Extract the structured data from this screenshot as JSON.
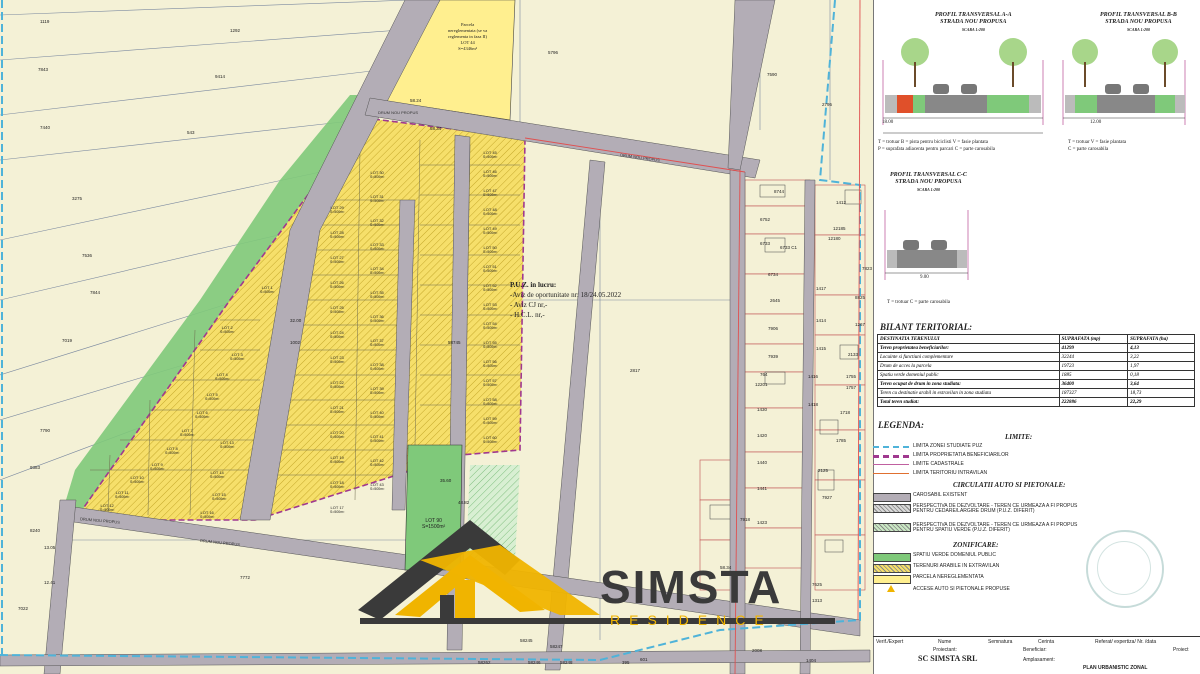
{
  "brand": {
    "name": "SIMSTA",
    "subtitle": "RESIDENCE"
  },
  "colors": {
    "agricultural": "#f4f1d6",
    "parcel_yellow": "#ffef8f",
    "lots_yellow": "#f6df6a",
    "roads_gray": "#b3adb6",
    "green_public": "#7fc97a",
    "purple_limit": "#a0388f",
    "blue_limit": "#4fb3d9",
    "cadastral_red": "#e05050",
    "brand_gray": "#3a3a3a",
    "brand_yellow": "#f0b400"
  },
  "puz_note": {
    "title": "P.U.Z. in lucru:",
    "lines": [
      "-Aviz de oportunitate nr: 18/24.05.2022",
      "- Aviz CJ nr,-",
      "- H.C.L. nr,-"
    ]
  },
  "parcela_note": [
    "Parcela",
    "nereglementata (se va",
    "reglementa in faza II)",
    "LOT 44",
    "S=4346m²"
  ],
  "map_labels": {
    "parcels": [
      "1119",
      "1292",
      "7843",
      "9414",
      "7440",
      "543",
      "3275",
      "7536",
      "7844",
      "7019",
      "7790",
      "9383",
      "8240",
      "7022",
      "7772",
      "5796",
      "7590",
      "2795",
      "2817",
      "8744",
      "6752",
      "6733",
      "6733 C1",
      "6734",
      "2645",
      "7906",
      "7939",
      "764",
      "12201",
      "1430",
      "1420",
      "1440",
      "1441",
      "7918",
      "2125",
      "7927",
      "1423",
      "1416",
      "1418",
      "1414",
      "1415",
      "1417",
      "1755",
      "1757",
      "1718",
      "1785",
      "2133",
      "7625",
      "1313",
      "601",
      "58247",
      "58246",
      "58248",
      "58262",
      "58245",
      "395",
      "2008",
      "1404",
      "1412",
      "12185",
      "12180",
      "8825",
      "1267",
      "7823"
    ],
    "lots": [
      "LOT 1",
      "LOT 2",
      "LOT 3",
      "LOT 4",
      "LOT 5",
      "LOT 6",
      "LOT 7",
      "LOT 8",
      "LOT 9",
      "LOT 10",
      "LOT 11",
      "LOT 12",
      "LOT 13",
      "LOT 14",
      "LOT 15",
      "LOT 16",
      "LOT 17",
      "LOT 18",
      "LOT 19",
      "LOT 20",
      "LOT 21",
      "LOT 22",
      "LOT 23",
      "LOT 24",
      "LOT 25",
      "LOT 26",
      "LOT 27",
      "LOT 28",
      "LOT 29",
      "LOT 30",
      "LOT 31",
      "LOT 32",
      "LOT 33",
      "LOT 34",
      "LOT 35",
      "LOT 36",
      "LOT 37",
      "LOT 38",
      "LOT 39",
      "LOT 40",
      "LOT 41",
      "LOT 42",
      "LOT 43",
      "LOT 45",
      "LOT 46",
      "LOT 47",
      "LOT 48",
      "LOT 49",
      "LOT 50",
      "LOT 51",
      "LOT 52",
      "LOT 53",
      "LOT 54",
      "LOT 55",
      "LOT 56",
      "LOT 57",
      "LOT 58",
      "LOT 59",
      "LOT 60"
    ],
    "lot_area": "S=500m²",
    "lot_big": "LOT 90",
    "lot_big_area": "S=1500m²",
    "roads": [
      "DRUM NOU PROPUS",
      "DRUM NOU PROPUS",
      "DRUM NOU PROPUS",
      "DRUM NOU PROPUS"
    ],
    "dims": [
      "58.24",
      "32.00",
      "1002",
      "58745",
      "35.60",
      "48.82",
      "12.41",
      "13.05",
      "58.34",
      "58.34"
    ]
  },
  "profiles": [
    {
      "title": "PROFIL TRANSVERSAL A-A",
      "subtitle": "STRADA NOU PROPUSA",
      "scale": "SCARA 1:200",
      "dims": [
        "1.50",
        "3.00",
        "2.00",
        "3.50",
        "3.50",
        "2.00",
        "3.00",
        "1.50"
      ],
      "total": "18.00",
      "legend": [
        "T = trotuar   B = pista pentru biciclisti  V = fasie plantata",
        "P = suprafata adiacenta pentru parcari   C = parte carosabila"
      ]
    },
    {
      "title": "PROFIL TRANSVERSAL B-B",
      "subtitle": "STRADA NOU PROPUSA",
      "scale": "SCARA 1:200",
      "dims": [
        "1.50",
        "3.00",
        "2.50",
        "3.50",
        "3.00",
        "1.50"
      ],
      "total": "12.00",
      "legend": [
        "T = trotuar   V = fasie plantata",
        "C = parte carosabila"
      ]
    },
    {
      "title": "PROFIL TRANSVERSAL C-C",
      "subtitle": "STRADA NOU PROPUSA",
      "scale": "SCARA 1:200",
      "dims": [
        "1.50",
        "3.00",
        "3.00",
        "1.50"
      ],
      "total": "9.00",
      "legend": [
        "T = trotuar   C = parte carosabila"
      ]
    }
  ],
  "profile_side_label": "limita cadastrala",
  "bilant": {
    "title": "BILANT TERITORIAL:",
    "headers": [
      "DESTINATIA TERENULUI",
      "SUPRAFATA (mp)",
      "SUPRAFATA (ha)"
    ],
    "rows": [
      [
        "Teren proprietatea beneficiarilor:",
        "41299",
        "4,13"
      ],
      [
        "Locuinte si functiuni complementare",
        "32244",
        "3,22"
      ],
      [
        "Drum de acces la parcela",
        "19723",
        "1,97"
      ],
      [
        "Spatiu verde domeniul public",
        "1885",
        "0,18"
      ],
      [
        "Teren ocupat de drum in zona studiata:",
        "36400",
        "3,64"
      ],
      [
        "Teren cu destinatie arabil in extravilan in zona studiata",
        "187327",
        "18,73"
      ],
      [
        "Total teren studiat:",
        "222886",
        "22,29"
      ]
    ]
  },
  "legend": {
    "title": "LEGENDA:",
    "limite_title": "LIMITE:",
    "limite": [
      {
        "label": "LIMITA ZONEI STUDIATE PUZ",
        "color": "#4fb3d9",
        "style": "dashed"
      },
      {
        "label": "LIMITA PROPRIETATIA BENEFICIARILOR",
        "color": "#a0388f",
        "style": "dashed-thick"
      },
      {
        "label": "LIMITE CADASTRALE",
        "color": "#c060a0",
        "style": "solid"
      },
      {
        "label": "LIMITA TERITORIU INTRAVILAN",
        "color": "#e07030",
        "style": "solid"
      }
    ],
    "circ_title": "CIRCULATII AUTO SI PIETONALE:",
    "circ": [
      {
        "label": "CAROSABIL EXISTENT",
        "fill": "#b3adb6",
        "pattern": "solid"
      },
      {
        "label": "PERSPECTIVA DE DEZVOLTARE - TEREN CE URMEAZA A FI PROPUS PENTRU CEDARE/LARGIRE DRUM (P.U.Z. DIFERIT)",
        "fill": "#d8d8d8",
        "pattern": "hatch"
      },
      {
        "label": "PERSPECTIVA DE DEZVOLTARE - TEREN CE URMEAZA A FI PROPUS PENTRU SPATIU VERDE (P.U.Z. DIFERIT)",
        "fill": "#c9e8c3",
        "pattern": "hatch"
      }
    ],
    "zon_title": "ZONIFICARE:",
    "zon": [
      {
        "label": "SPATIU VERDE DOMENIUL PUBLIC",
        "fill": "#7fc97a",
        "pattern": "solid"
      },
      {
        "label": "TERENURI ARABILE IN EXTRAVILAN",
        "fill": "#f6df6a",
        "pattern": "hatch"
      },
      {
        "label": "PARCELA NEREGLEMENTATA",
        "fill": "#ffef8f",
        "pattern": "solid"
      }
    ],
    "access": "ACCESE AUTO SI PIETONALE PROPUSE"
  },
  "titleblock": {
    "cols": [
      "Verif./Expert",
      "Nume",
      "Semnatura",
      "Cerinta",
      "Referat/ expertiza/ Nr. /data"
    ],
    "designer_label": "Proiectant:",
    "designer": "SC SIMSTA SRL",
    "beneficiar_label": "Beneficiar:",
    "amplasament_label": "Amplasament:",
    "plan": "PLAN URBANISTIC ZONAL",
    "project_label": "Proiect"
  }
}
